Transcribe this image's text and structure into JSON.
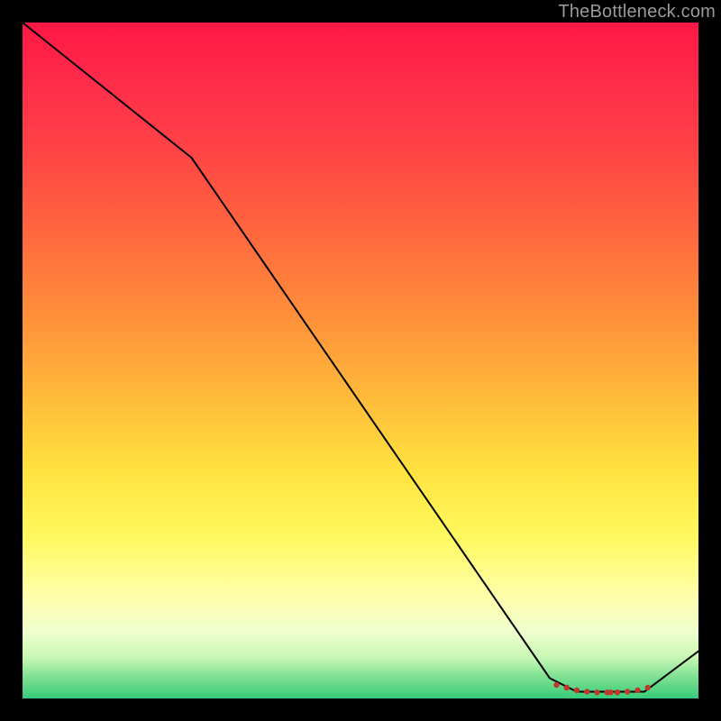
{
  "watermark": {
    "text": "TheBottleneck.com"
  },
  "chart_data": {
    "type": "line",
    "title": "",
    "xlabel": "",
    "ylabel": "",
    "xlim": [
      0,
      100
    ],
    "ylim": [
      0,
      100
    ],
    "grid": false,
    "legend": false,
    "background_gradient": {
      "direction": "vertical",
      "stops": [
        {
          "pos": 0.0,
          "color": "#ff1744"
        },
        {
          "pos": 0.32,
          "color": "#ff6a3e"
        },
        {
          "pos": 0.55,
          "color": "#ffb93a"
        },
        {
          "pos": 0.76,
          "color": "#fff95e"
        },
        {
          "pos": 0.9,
          "color": "#f0ffce"
        },
        {
          "pos": 1.0,
          "color": "#36cc7a"
        }
      ]
    },
    "series": [
      {
        "name": "bottleneck-curve",
        "color": "#000000",
        "stroke_width": 2,
        "x": [
          0,
          25,
          78,
          82,
          92,
          100
        ],
        "y": [
          100,
          80,
          3,
          1,
          1,
          7
        ]
      }
    ],
    "markers": {
      "name": "optimal-range-dots",
      "color": "#c0392b",
      "radius": 3.2,
      "points": [
        {
          "x": 79.0,
          "y": 2.0
        },
        {
          "x": 80.5,
          "y": 1.6
        },
        {
          "x": 82.0,
          "y": 1.2
        },
        {
          "x": 83.5,
          "y": 1.0
        },
        {
          "x": 85.0,
          "y": 0.9
        },
        {
          "x": 86.5,
          "y": 0.9
        },
        {
          "x": 87.0,
          "y": 0.9
        },
        {
          "x": 88.0,
          "y": 0.9
        },
        {
          "x": 89.5,
          "y": 1.0
        },
        {
          "x": 91.0,
          "y": 1.2
        },
        {
          "x": 92.5,
          "y": 1.6
        }
      ]
    }
  }
}
